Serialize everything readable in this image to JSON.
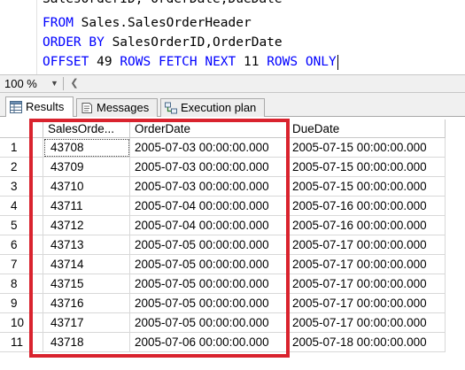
{
  "editor": {
    "lines": [
      [
        {
          "text": "SalesOrderID, OrderDate,DueDate",
          "kind": "plain"
        }
      ],
      [
        {
          "text": "FROM",
          "kind": "keyword"
        },
        {
          "text": " Sales.SalesOrderHeader",
          "kind": "plain"
        }
      ],
      [
        {
          "text": "ORDER BY",
          "kind": "keyword"
        },
        {
          "text": " SalesOrderID,OrderDate",
          "kind": "plain"
        }
      ],
      [
        {
          "text": "OFFSET",
          "kind": "keyword"
        },
        {
          "text": " 49 ",
          "kind": "plain"
        },
        {
          "text": "ROWS FETCH NEXT",
          "kind": "keyword"
        },
        {
          "text": " 11 ",
          "kind": "plain"
        },
        {
          "text": "ROWS ONLY",
          "kind": "keyword"
        }
      ]
    ]
  },
  "zoom": {
    "value": "100 %",
    "dropdown_icon": "chevron-down-icon",
    "scroll_icon": "chevron-left-icon"
  },
  "tabs": [
    {
      "label": "Results",
      "icon": "grid-icon",
      "active": true
    },
    {
      "label": "Messages",
      "icon": "messages-icon",
      "active": false
    },
    {
      "label": "Execution plan",
      "icon": "execution-plan-icon",
      "active": false
    }
  ],
  "grid": {
    "columns": [
      "SalesOrde...",
      "OrderDate",
      "DueDate"
    ],
    "rows": [
      {
        "num": "1",
        "cells": [
          "43708",
          "2005-07-03 00:00:00.000",
          "2005-07-15 00:00:00.000"
        ]
      },
      {
        "num": "2",
        "cells": [
          "43709",
          "2005-07-03 00:00:00.000",
          "2005-07-15 00:00:00.000"
        ]
      },
      {
        "num": "3",
        "cells": [
          "43710",
          "2005-07-03 00:00:00.000",
          "2005-07-15 00:00:00.000"
        ]
      },
      {
        "num": "4",
        "cells": [
          "43711",
          "2005-07-04 00:00:00.000",
          "2005-07-16 00:00:00.000"
        ]
      },
      {
        "num": "5",
        "cells": [
          "43712",
          "2005-07-04 00:00:00.000",
          "2005-07-16 00:00:00.000"
        ]
      },
      {
        "num": "6",
        "cells": [
          "43713",
          "2005-07-05 00:00:00.000",
          "2005-07-17 00:00:00.000"
        ]
      },
      {
        "num": "7",
        "cells": [
          "43714",
          "2005-07-05 00:00:00.000",
          "2005-07-17 00:00:00.000"
        ]
      },
      {
        "num": "8",
        "cells": [
          "43715",
          "2005-07-05 00:00:00.000",
          "2005-07-17 00:00:00.000"
        ]
      },
      {
        "num": "9",
        "cells": [
          "43716",
          "2005-07-05 00:00:00.000",
          "2005-07-17 00:00:00.000"
        ]
      },
      {
        "num": "10",
        "cells": [
          "43717",
          "2005-07-05 00:00:00.000",
          "2005-07-17 00:00:00.000"
        ]
      },
      {
        "num": "11",
        "cells": [
          "43718",
          "2005-07-06 00:00:00.000",
          "2005-07-18 00:00:00.000"
        ]
      }
    ],
    "selected_row": 1,
    "selected_column": 1
  },
  "colors": {
    "keyword": "#0000ff",
    "highlight_border": "#d9232e",
    "grid_line": "#d8d8d8"
  }
}
